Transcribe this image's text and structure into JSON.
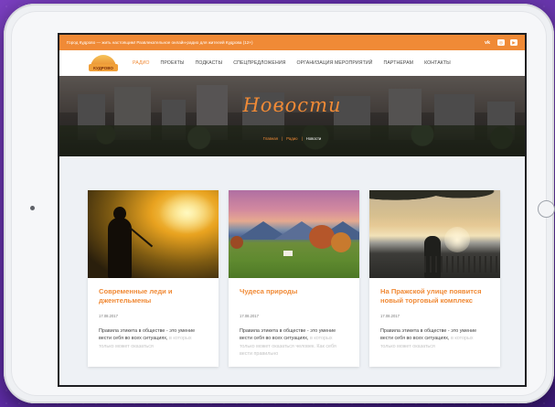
{
  "topbar": {
    "tagline": "Город Кудрово — жить настоящим! Развлекательное онлайн-радио для жителей Кудрова (12+)",
    "socials": [
      "vk-icon",
      "instagram-icon",
      "youtube-icon"
    ]
  },
  "logo": {
    "text": "КУДРОВО"
  },
  "nav": {
    "items": [
      {
        "label": "РАДИО",
        "active": true
      },
      {
        "label": "ПРОЕКТЫ"
      },
      {
        "label": "ПОДКАСТЫ"
      },
      {
        "label": "СПЕЦПРЕДЛОЖЕНИЯ"
      },
      {
        "label": "ОРГАНИЗАЦИЯ МЕРОПРИЯТИЙ"
      },
      {
        "label": "ПАРТНЕРАМ"
      },
      {
        "label": "КОНТАКТЫ"
      }
    ]
  },
  "hero": {
    "title": "Новости",
    "breadcrumb": [
      "Главная",
      "Радио",
      "Новости"
    ]
  },
  "cards": [
    {
      "title": "Современные леди и джентельмены",
      "date": "17.08.2017",
      "text": "Правила этикета в обществе - это умение вести себя во всех ситуациях,",
      "text_fade": "в которых только может оказаться"
    },
    {
      "title": "Чудеса природы",
      "date": "17.08.2017",
      "text": "Правила этикета в обществе - это умение вести себя во всех ситуациях,",
      "text_fade": "в которых только может оказаться человек. Как себя вести правильно"
    },
    {
      "title": "На Пражской улице появится новый торговый комплекс",
      "date": "17.08.2017",
      "text": "Правила этикета в обществе - это умение вести себя во всех ситуациях,",
      "text_fade": "в которых только может оказаться"
    }
  ],
  "colors": {
    "accent": "#f08a36",
    "background": "#5b2aa3"
  }
}
